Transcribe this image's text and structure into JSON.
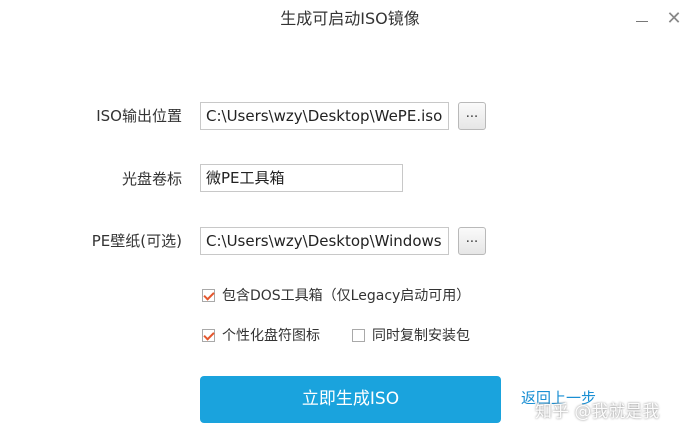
{
  "window": {
    "title": "生成可启动ISO镜像",
    "minimize_icon": "minimize-icon",
    "close_icon": "close-icon",
    "close_glyph": "✕"
  },
  "form": {
    "iso_output": {
      "label": "ISO输出位置",
      "value": "C:\\Users\\wzy\\Desktop\\WePE.iso",
      "browse_label": "..."
    },
    "volume_label": {
      "label": "光盘卷标",
      "value": "微PE工具箱"
    },
    "wallpaper": {
      "label": "PE壁纸(可选)",
      "value": "C:\\Users\\wzy\\Desktop\\Windows",
      "browse_label": "..."
    }
  },
  "options": {
    "include_dos": {
      "label": "包含DOS工具箱（仅Legacy启动可用）",
      "checked": true
    },
    "personalize_icons": {
      "label": "个性化盘符图标",
      "checked": true
    },
    "copy_installer": {
      "label": "同时复制安装包",
      "checked": false
    }
  },
  "actions": {
    "generate_label": "立即生成ISO",
    "back_label": "返回上一步"
  },
  "watermark": "知乎 @我就是我",
  "colors": {
    "primary": "#1aa3dd",
    "link": "#1a8fd3",
    "check": "#e4572e"
  }
}
